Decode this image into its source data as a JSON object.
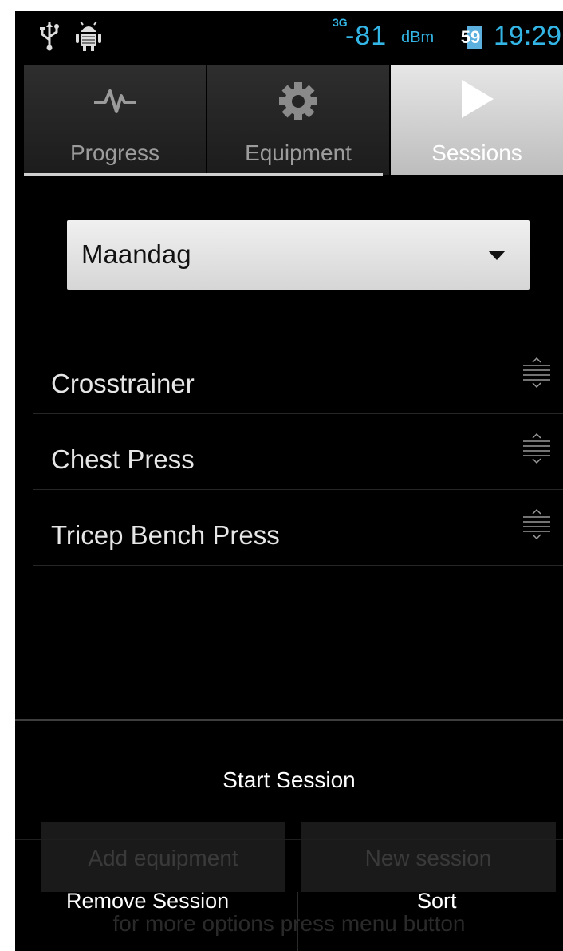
{
  "status_bar": {
    "network_type": "3G",
    "signal_value": "-81",
    "signal_unit": "dBm",
    "battery_level": "59",
    "time": "19:29",
    "accent_color": "#33b5e5",
    "icons": [
      "usb-icon",
      "android-debug-icon",
      "battery-icon"
    ]
  },
  "tabs": [
    {
      "label": "Progress",
      "icon": "pulse-icon",
      "selected": false
    },
    {
      "label": "Equipment",
      "icon": "gear-icon",
      "selected": false
    },
    {
      "label": "Sessions",
      "icon": "play-icon",
      "selected": true
    }
  ],
  "session_selector": {
    "selected": "Maandag",
    "icon": "dropdown-caret-icon"
  },
  "equipment_list": [
    {
      "name": "Crosstrainer",
      "icon": "drag-handle-icon"
    },
    {
      "name": "Chest Press",
      "icon": "drag-handle-icon"
    },
    {
      "name": "Tricep Bench Press",
      "icon": "drag-handle-icon"
    }
  ],
  "start_session_label": "Start Session",
  "background_buttons": {
    "add_equipment": "Add equipment",
    "new_session": "New session",
    "hint": "for more options press menu button"
  },
  "menu": {
    "remove_session": "Remove Session",
    "sort": "Sort"
  }
}
